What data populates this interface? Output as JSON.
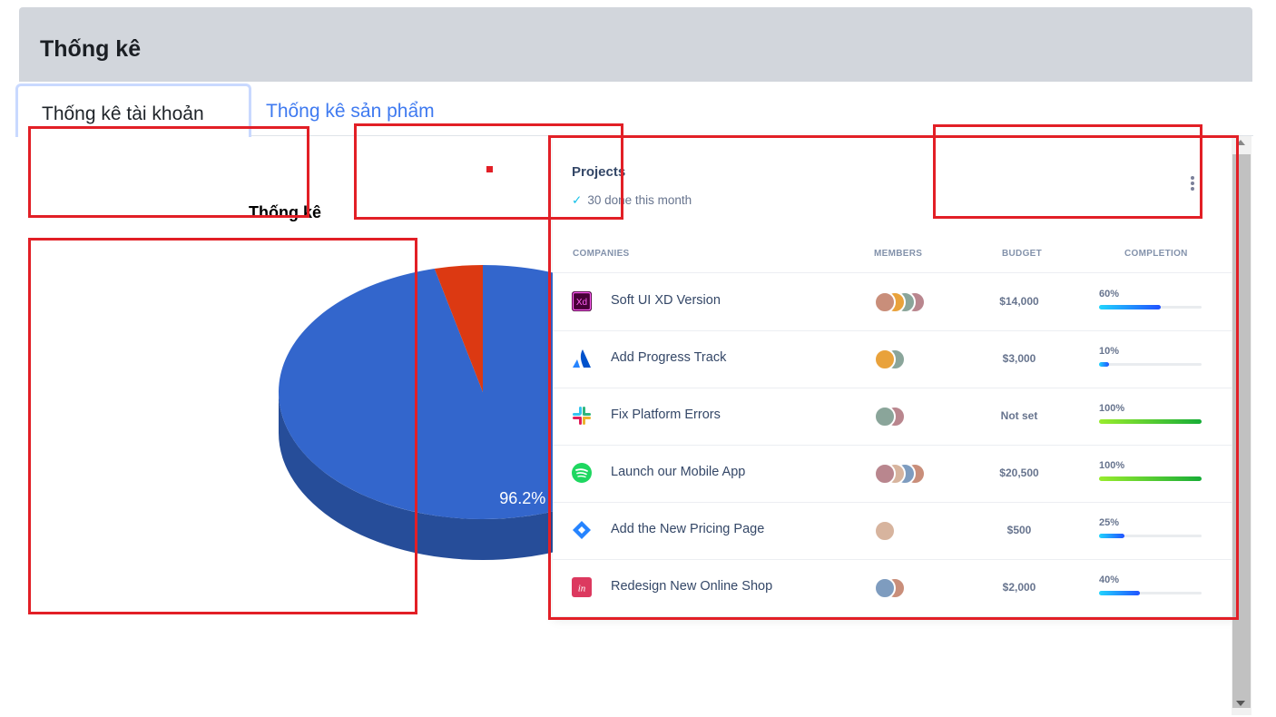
{
  "header": {
    "title": "Thống kê"
  },
  "tabs": [
    {
      "label": "Thống kê tài khoản",
      "active": true
    },
    {
      "label": "Thống kê sản phẩm",
      "active": false
    }
  ],
  "chart_data": {
    "type": "pie",
    "title": "Thống kê",
    "categories": [
      "",
      ""
    ],
    "values": [
      96.2,
      3.8
    ],
    "data_labels": [
      "96.2%",
      ""
    ],
    "colors": [
      "#3366cc",
      "#dc3912"
    ],
    "style": "3d"
  },
  "projects": {
    "title": "Projects",
    "subtitle": "30 done this month",
    "columns": [
      "COMPANIES",
      "MEMBERS",
      "BUDGET",
      "COMPLETION"
    ],
    "rows": [
      {
        "name": "Soft UI XD Version",
        "logo": "adobe-xd-icon",
        "members": 4,
        "budget": "$14,000",
        "completion": "60%",
        "progress": 0.6,
        "bar_color": "blue"
      },
      {
        "name": "Add Progress Track",
        "logo": "atlassian-icon",
        "members": 2,
        "budget": "$3,000",
        "completion": "10%",
        "progress": 0.1,
        "bar_color": "blue"
      },
      {
        "name": "Fix Platform Errors",
        "logo": "slack-icon",
        "members": 2,
        "budget": "Not set",
        "completion": "100%",
        "progress": 1.0,
        "bar_color": "green"
      },
      {
        "name": "Launch our Mobile App",
        "logo": "spotify-icon",
        "members": 4,
        "budget": "$20,500",
        "completion": "100%",
        "progress": 1.0,
        "bar_color": "green"
      },
      {
        "name": "Add the New Pricing Page",
        "logo": "jira-icon",
        "members": 1,
        "budget": "$500",
        "completion": "25%",
        "progress": 0.25,
        "bar_color": "blue"
      },
      {
        "name": "Redesign New Online Shop",
        "logo": "invision-icon",
        "members": 2,
        "budget": "$2,000",
        "completion": "40%",
        "progress": 0.4,
        "bar_color": "blue"
      }
    ]
  },
  "colors": {
    "header_bg": "#d2d6dc",
    "tab_link": "#3f7af0",
    "annotation_red": "#e21f26",
    "progress_blue": "#2152ff",
    "progress_green": "#17ad37"
  }
}
